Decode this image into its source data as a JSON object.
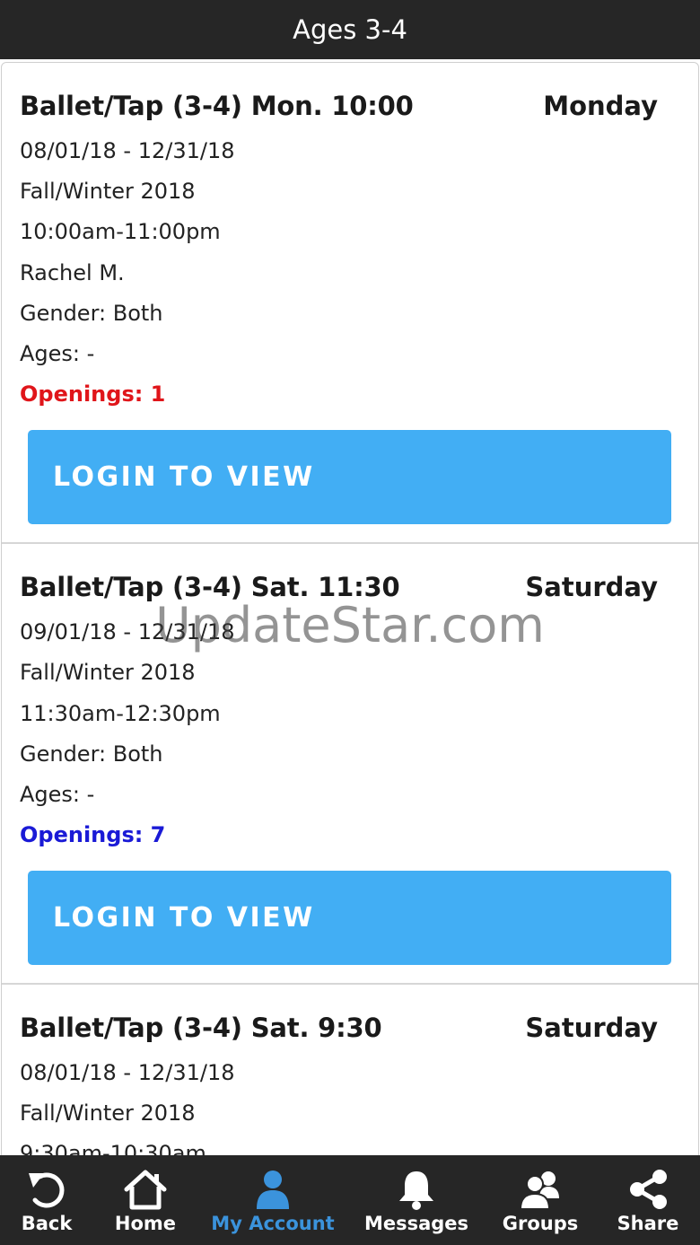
{
  "header": {
    "title": "Ages 3-4"
  },
  "classes": [
    {
      "title": "Ballet/Tap (3-4) Mon. 10:00",
      "day": "Monday",
      "dates": "08/01/18 - 12/31/18",
      "season": "Fall/Winter 2018",
      "time": "10:00am-11:00pm",
      "instructor": "Rachel M.",
      "gender": "Gender: Both",
      "ages": "Ages: -",
      "openings": "Openings: 1",
      "openings_color": "#e0151a",
      "button_label": "LOGIN TO VIEW"
    },
    {
      "title": "Ballet/Tap (3-4) Sat. 11:30",
      "day": "Saturday",
      "dates": "09/01/18 - 12/31/18",
      "season": "Fall/Winter 2018",
      "time": "11:30am-12:30pm",
      "gender": "Gender: Both",
      "ages": "Ages: -",
      "openings": "Openings: 7",
      "openings_color": "#1a1ad6",
      "button_label": "LOGIN TO VIEW"
    },
    {
      "title": "Ballet/Tap (3-4) Sat. 9:30",
      "day": "Saturday",
      "dates": "08/01/18 - 12/31/18",
      "season": "Fall/Winter 2018",
      "time": "9:30am-10:30am"
    }
  ],
  "watermark": "UpdateStar.com",
  "tabbar": {
    "items": [
      {
        "label": "Back",
        "icon": "back-arrow-icon"
      },
      {
        "label": "Home",
        "icon": "home-icon"
      },
      {
        "label": "My Account",
        "icon": "user-icon",
        "active": true
      },
      {
        "label": "Messages",
        "icon": "bell-icon"
      },
      {
        "label": "Groups",
        "icon": "group-icon"
      },
      {
        "label": "Share",
        "icon": "share-icon"
      }
    ],
    "active_color": "#3b93dc"
  },
  "colors": {
    "header_bg": "#262626",
    "button_bg": "#42aef4",
    "tabbar_bg": "#262626"
  }
}
